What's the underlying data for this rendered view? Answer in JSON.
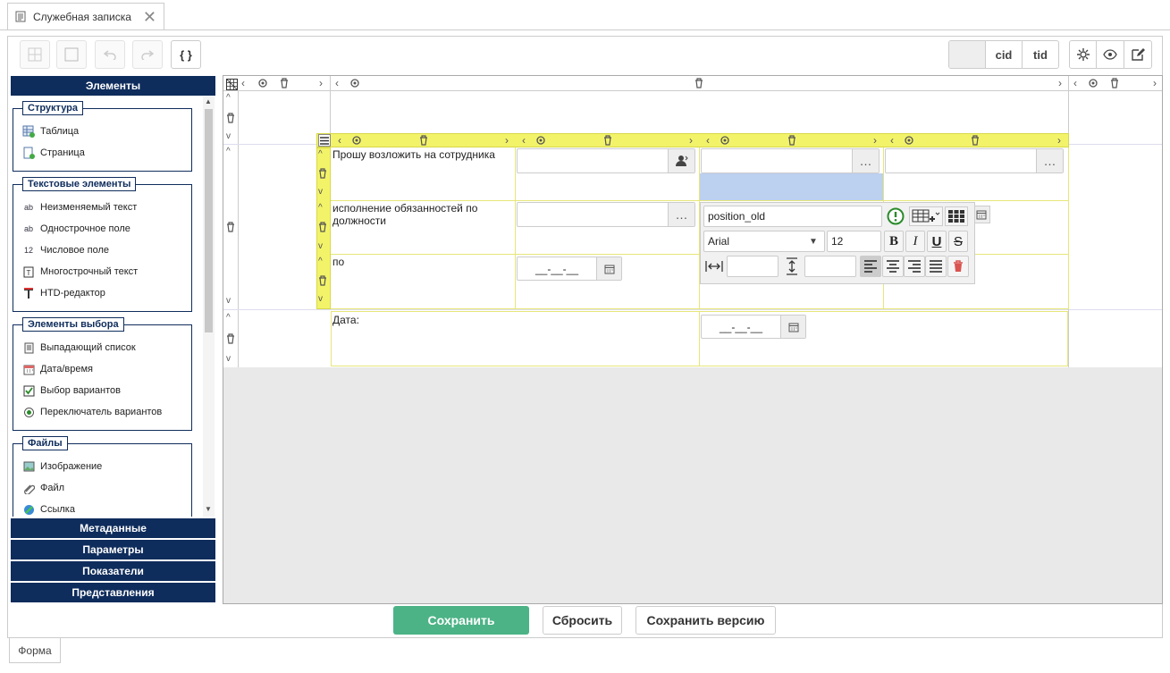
{
  "tab": {
    "title": "Служебная записка"
  },
  "toolbar": {
    "braces": "{ }",
    "cid": "cid",
    "tid": "tid"
  },
  "left": {
    "header": "Элементы",
    "groups": [
      {
        "title": "Структура",
        "items": [
          "Таблица",
          "Страница"
        ]
      },
      {
        "title": "Текстовые элементы",
        "items": [
          "Неизменяемый текст",
          "Однострочное поле",
          "Числовое поле",
          "Многострочный текст",
          "HTD-редактор"
        ]
      },
      {
        "title": "Элементы выбора",
        "items": [
          "Выпадающий список",
          "Дата/время",
          "Выбор вариантов",
          "Переключатель вариантов"
        ]
      },
      {
        "title": "Файлы",
        "items": [
          "Изображение",
          "Файл",
          "Ссылка"
        ]
      }
    ],
    "accordion": [
      "Метаданные",
      "Параметры",
      "Показатели",
      "Представления"
    ]
  },
  "form": {
    "row1_text": "Прошу возложить на сотрудника",
    "row2_text": "исполнение обязанностей по должности",
    "row3_text": "по",
    "date_label": "Дата:",
    "date_mask": "__-__-__"
  },
  "popup": {
    "field_name": "position_old",
    "font": "Arial",
    "font_size": "12",
    "bold": "B",
    "italic": "I",
    "underline": "U",
    "strike": "S"
  },
  "buttons": {
    "save": "Сохранить",
    "reset": "Сбросить",
    "save_version": "Сохранить версию"
  },
  "bottom_tab": "Форма",
  "colors": {
    "navy": "#0f2d5c",
    "yellow": "#f3f36a",
    "green": "#4cb386",
    "select_blue": "#bcd0ef",
    "delete_red": "#d9534f"
  }
}
